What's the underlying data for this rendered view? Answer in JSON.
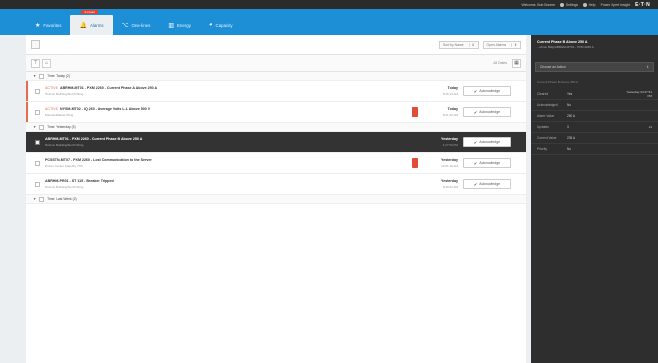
{
  "topbar": {
    "welcome": "Welcome, Bob Bonner",
    "settings": "Settings",
    "help": "Help",
    "open": "Power Xpert Insight",
    "brand": "E·T·N"
  },
  "nav": {
    "tabs": [
      {
        "label": "Favorites",
        "icon": "★"
      },
      {
        "label": "Alarms",
        "icon": "🔔",
        "badge": "3 unread"
      },
      {
        "label": "One-lines",
        "icon": "⌥"
      },
      {
        "label": "Energy",
        "icon": "▥"
      },
      {
        "label": "Capacity",
        "icon": "◕"
      }
    ]
  },
  "toolbar": {
    "sort_label": "Sort by Name",
    "filter_label": "Open Alarms",
    "all_dates": "All Dates"
  },
  "groups": {
    "today": "Time: Today (2)",
    "yesterday": "Time: Yesterday (3)",
    "lastweek": "Time: Last Week (2)"
  },
  "alarms": [
    {
      "tag": "ACTIVE",
      "title": "ABRHM-MT01 - PXM 2260 - Current Phase A Above 250 A",
      "location": "Hebron Building/North Wing",
      "date": "Today",
      "time": "8:25:14 AM",
      "ack": "Acknowledge"
    },
    {
      "tag": "ACTIVE",
      "title": "NYSM-MT02 - IQ 260 - Average Volts L-L Above 500 V",
      "location": "Mansfield/East Wing",
      "date": "Today",
      "time": "8:21:45 AM",
      "ack": "Acknowledge"
    },
    {
      "tag": "",
      "title": "ABRHM-MT01 - PXM 2260 - Current Phase B Above 250 A",
      "location": "Hebron Building/North Wing",
      "date": "Yesterday",
      "time": "4:27:50 PM",
      "ack": "Acknowledge"
    },
    {
      "tag": "",
      "title": "PCSSTN-MT07 - PXM 2260 - Lost Communication to the Server",
      "location": "Power Center Standby 77th",
      "date": "Yesterday",
      "time": "10:01:16 AM",
      "ack": "Acknowledge"
    },
    {
      "tag": "",
      "title": "ABRHM-PR01 - ST 115 - Breaker Tripped",
      "location": "Hebron Building/North Wing",
      "date": "Yesterday",
      "time": "8:49:22 AM",
      "ack": "Acknowledge"
    }
  ],
  "detail": {
    "title": "Current Phase B Above 250 A",
    "subtitle": "...ebron Bldg/ABRHM-MT01 - PXM 2260 A",
    "actions_placeholder": "Choose an Action",
    "section": "Current Phase B Above 250 A",
    "fields": [
      {
        "key": "Cleared",
        "value": "Yes",
        "extra": "Yesterday 04:27:51 PM"
      },
      {
        "key": "Acknowledged",
        "value": "No",
        "extra": ""
      },
      {
        "key": "Alarm Value",
        "value": "250 A",
        "extra": ""
      },
      {
        "key": "Updates",
        "value": "3",
        "extra": "14"
      },
      {
        "key": "Current Value",
        "value": "235 A",
        "extra": ""
      },
      {
        "key": "Priority",
        "value": "No",
        "extra": ""
      }
    ]
  }
}
